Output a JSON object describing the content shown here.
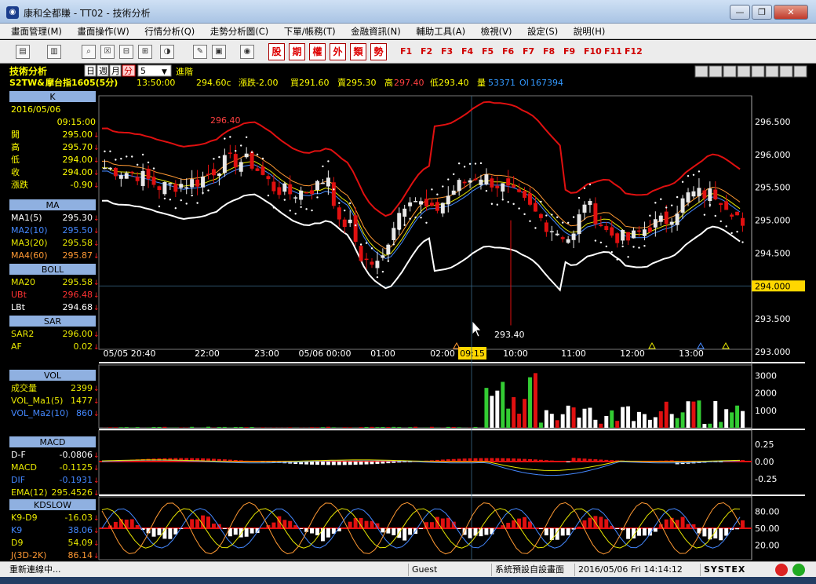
{
  "window": {
    "title": "康和全都賺 - TT02 - 技術分析",
    "minimize": "—",
    "restore": "❐",
    "close": "✕"
  },
  "menu": [
    "畫面管理(M)",
    "畫面操作(W)",
    "行情分析(Q)",
    "走勢分析圖(C)",
    "下單/帳務(T)",
    "金融資訊(N)",
    "輔助工具(A)",
    "檢視(V)",
    "設定(S)",
    "說明(H)"
  ],
  "toolbar": {
    "red_buttons": [
      "股",
      "期",
      "權",
      "外",
      "類",
      "勢"
    ],
    "fkeys": [
      "F1",
      "F2",
      "F3",
      "F4",
      "F5",
      "F6",
      "F7",
      "F8",
      "F9",
      "F10",
      "F11",
      "F12"
    ]
  },
  "header": {
    "title": "技術分析",
    "periods": [
      "日",
      "週",
      "月",
      "分"
    ],
    "active_period": "分",
    "interval": "5",
    "advanced": "進階",
    "symbol": "S2TW&",
    "name": "摩台指1605(5分)",
    "time": "13:50:00",
    "price": "294.60c",
    "change": "漲跌-2.00",
    "bid": "買291.60",
    "ask": "賣295.30",
    "high_label": "高",
    "high": "297.40",
    "low": "低293.40",
    "volume_label": "量",
    "volume": "53371",
    "oi_label": "OI",
    "oi": "167394"
  },
  "left_panel": {
    "k": {
      "header": "K",
      "date": "2016/05/06",
      "time": "09:15:00",
      "rows": [
        {
          "label": "開",
          "value": "295.00"
        },
        {
          "label": "高",
          "value": "295.70"
        },
        {
          "label": "低",
          "value": "294.00"
        },
        {
          "label": "收",
          "value": "294.00"
        },
        {
          "label": "漲跌",
          "value": "-0.90"
        }
      ]
    },
    "ma": {
      "header": "MA",
      "rows": [
        {
          "label": "MA1(5)",
          "value": "295.30",
          "color": "#ffffff"
        },
        {
          "label": "MA2(10)",
          "value": "295.50",
          "color": "#4488ff"
        },
        {
          "label": "MA3(20)",
          "value": "295.58",
          "color": "#e8e800"
        },
        {
          "label": "MA4(60)",
          "value": "295.87",
          "color": "#ff9933"
        }
      ]
    },
    "boll": {
      "header": "BOLL",
      "rows": [
        {
          "label": "MA20",
          "value": "295.58",
          "color": "#e8e800"
        },
        {
          "label": "UBt",
          "value": "296.48",
          "color": "#ff3333"
        },
        {
          "label": "LBt",
          "value": "294.68",
          "color": "#ffffff"
        }
      ]
    },
    "sar": {
      "header": "SAR",
      "rows": [
        {
          "label": "SAR2",
          "value": "296.00",
          "color": "#e8e800"
        },
        {
          "label": "AF",
          "value": "0.02",
          "color": "#e8e800"
        }
      ]
    },
    "vol": {
      "header": "VOL",
      "rows": [
        {
          "label": "成交量",
          "value": "2399",
          "color": "#e8e800"
        },
        {
          "label": "VOL_Ma1(5)",
          "value": "1477",
          "color": "#e8e800"
        },
        {
          "label": "VOL_Ma2(10)",
          "value": "860",
          "color": "#4488ff"
        }
      ]
    },
    "macd": {
      "header": "MACD",
      "rows": [
        {
          "label": "D-F",
          "value": "-0.0806",
          "color": "#ffffff"
        },
        {
          "label": "MACD",
          "value": "-0.1125",
          "color": "#e8e800"
        },
        {
          "label": "DIF",
          "value": "-0.1931",
          "color": "#4488ff"
        },
        {
          "label": "EMA(12)",
          "value": "295.4526",
          "color": "#e8e800"
        }
      ]
    },
    "kd": {
      "header": "KDSLOW",
      "rows": [
        {
          "label": "K9-D9",
          "value": "-16.03",
          "color": "#e8e800"
        },
        {
          "label": "K9",
          "value": "38.06",
          "color": "#4488ff"
        },
        {
          "label": "D9",
          "value": "54.09",
          "color": "#e8e800"
        },
        {
          "label": "J(3D-2K)",
          "value": "86.14",
          "color": "#ff9933"
        }
      ]
    }
  },
  "axes": {
    "price_ticks": [
      "296.500",
      "296.000",
      "295.500",
      "295.000",
      "294.500",
      "293.500",
      "293.000"
    ],
    "current_price": "294.000",
    "time_ticks": [
      "05/05 20:40",
      "22:00",
      "23:00",
      "05/06 00:00",
      "01:00",
      "02:00",
      "09:15",
      "10:00",
      "11:00",
      "12:00",
      "13:00"
    ],
    "high_annotation": "296.40",
    "low_annotation": "293.40",
    "vol_ticks": [
      "3000",
      "2000",
      "1000"
    ],
    "macd_ticks": [
      "0.25",
      "0.00",
      "-0.25"
    ],
    "kd_ticks": [
      "80.00",
      "50.00",
      "20.00"
    ]
  },
  "status": {
    "message": "重新連線中...",
    "user": "Guest",
    "layout": "系統預設自設畫面",
    "datetime": "2016/05/06 Fri 14:14:12",
    "brand": "SYSTEX"
  },
  "colors": {
    "up": "#e8e8e8",
    "down": "#e01010",
    "upper_band": "#e01010",
    "lower_band": "#ffffff",
    "sar": "#ffffff",
    "grid": "#333333"
  }
}
